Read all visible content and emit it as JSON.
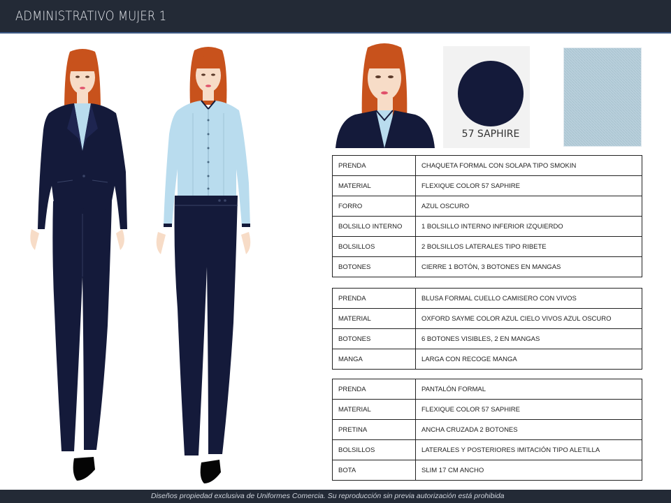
{
  "header": {
    "title": "ADMINISTRATIVO MUJER 1"
  },
  "swatch": {
    "label": "57 SAPHIRE"
  },
  "tables": [
    {
      "rows": [
        {
          "label": "PRENDA",
          "value": "CHAQUETA FORMAL CON SOLAPA TIPO SMOKIN"
        },
        {
          "label": "MATERIAL",
          "value": "FLEXIQUE COLOR 57 SAPHIRE"
        },
        {
          "label": "FORRO",
          "value": "AZUL OSCURO"
        },
        {
          "label": "BOLSILLO INTERNO",
          "value": "1 BOLSILLO INTERNO INFERIOR IZQUIERDO"
        },
        {
          "label": "BOLSILLOS",
          "value": "2 BOLSILLOS LATERALES TIPO RIBETE"
        },
        {
          "label": "BOTONES",
          "value": "CIERRE 1 BOTÓN, 3 BOTONES EN MANGAS"
        }
      ]
    },
    {
      "rows": [
        {
          "label": "PRENDA",
          "value": "BLUSA FORMAL CUELLO CAMISERO CON VIVOS"
        },
        {
          "label": "MATERIAL",
          "value": "OXFORD SAYME COLOR AZUL CIELO VIVOS AZUL OSCURO"
        },
        {
          "label": "BOTONES",
          "value": "6 BOTONES VISIBLES, 2 EN MANGAS"
        },
        {
          "label": "MANGA",
          "value": "LARGA CON RECOGE MANGA"
        }
      ]
    },
    {
      "rows": [
        {
          "label": "PRENDA",
          "value": "PANTALÓN FORMAL"
        },
        {
          "label": "MATERIAL",
          "value": "FLEXIQUE COLOR 57 SAPHIRE"
        },
        {
          "label": "PRETINA",
          "value": "ANCHA CRUZADA 2 BOTONES"
        },
        {
          "label": "BOLSILLOS",
          "value": "LATERALES Y POSTERIORES IMITACIÓN TIPO ALETILLA"
        },
        {
          "label": "BOTA",
          "value": "SLIM 17 CM ANCHO"
        }
      ]
    }
  ],
  "footer": {
    "text": "Diseños propiedad exclusiva de Uniformes Comercia. Su reproducción sin previa autorización está prohibida"
  },
  "colors": {
    "header_bg": "#232a36",
    "navy": "#141a3a",
    "shirt": "#b9dcee",
    "hair": "#c8521c",
    "skin": "#f7dcc7"
  }
}
